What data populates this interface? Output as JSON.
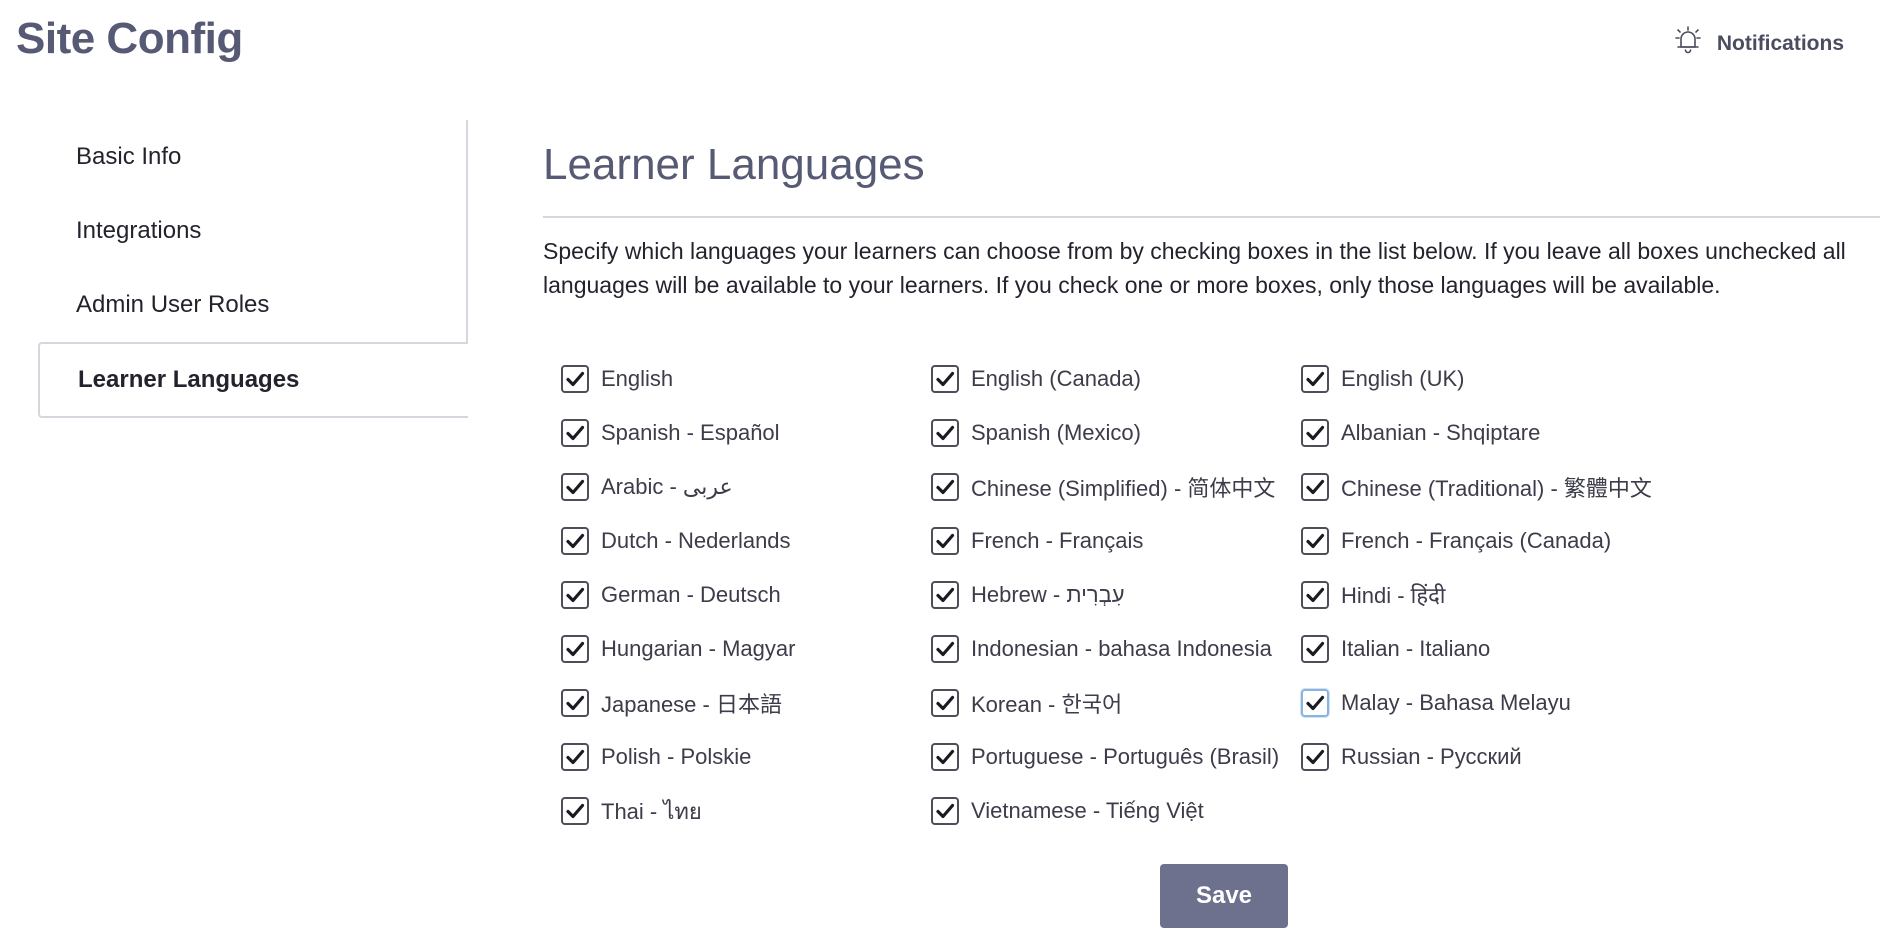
{
  "header": {
    "title": "Site Config",
    "notifications_label": "Notifications",
    "notifications_icon": "bell-icon"
  },
  "sidebar": {
    "items": [
      {
        "label": "Basic Info",
        "active": false
      },
      {
        "label": "Integrations",
        "active": false
      },
      {
        "label": "Admin User Roles",
        "active": false
      },
      {
        "label": "Learner Languages",
        "active": true
      }
    ]
  },
  "main": {
    "title": "Learner Languages",
    "description_line1": "Specify which languages your learners can choose from by checking boxes in the list below. If you leave all boxes unchecked all",
    "description_line2": "languages will be available to your learners. If you check one or more boxes, only those languages will be available.",
    "languages": [
      {
        "label": "English",
        "checked": true
      },
      {
        "label": "English (Canada)",
        "checked": true
      },
      {
        "label": "English (UK)",
        "checked": true
      },
      {
        "label": "Spanish - Español",
        "checked": true
      },
      {
        "label": "Spanish (Mexico)",
        "checked": true
      },
      {
        "label": "Albanian - Shqiptare",
        "checked": true
      },
      {
        "label": "Arabic - عربى",
        "checked": true
      },
      {
        "label": "Chinese (Simplified) - 简体中文",
        "checked": true
      },
      {
        "label": "Chinese (Traditional) - 繁體中文",
        "checked": true
      },
      {
        "label": "Dutch - Nederlands",
        "checked": true
      },
      {
        "label": "French - Français",
        "checked": true
      },
      {
        "label": "French - Français (Canada)",
        "checked": true
      },
      {
        "label": "German - Deutsch",
        "checked": true
      },
      {
        "label": "Hebrew - עִבְרִית",
        "checked": true
      },
      {
        "label": "Hindi - हिंदी",
        "checked": true
      },
      {
        "label": "Hungarian - Magyar",
        "checked": true
      },
      {
        "label": "Indonesian - bahasa Indonesia",
        "checked": true
      },
      {
        "label": "Italian - Italiano",
        "checked": true
      },
      {
        "label": "Japanese - 日本語",
        "checked": true
      },
      {
        "label": "Korean - 한국어",
        "checked": true
      },
      {
        "label": "Malay - Bahasa Melayu",
        "checked": true,
        "focused": true
      },
      {
        "label": "Polish - Polskie",
        "checked": true
      },
      {
        "label": "Portuguese - Português (Brasil)",
        "checked": true
      },
      {
        "label": "Russian - Русский",
        "checked": true
      },
      {
        "label": "Thai - ไทย",
        "checked": true
      },
      {
        "label": "Vietnamese - Tiếng Việt",
        "checked": true
      }
    ],
    "save_label": "Save"
  },
  "colors": {
    "title": "#575a74",
    "save_button": "#6e718e",
    "border": "#d6d6de",
    "focus": "#8ab4e0"
  }
}
